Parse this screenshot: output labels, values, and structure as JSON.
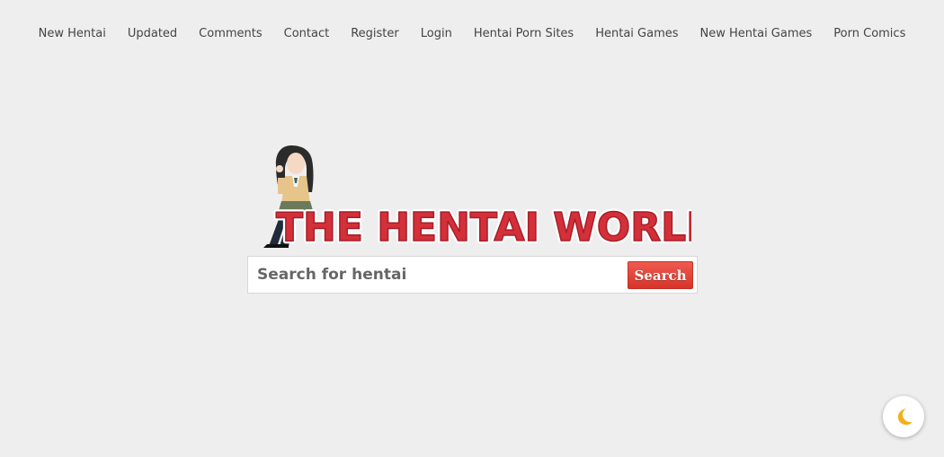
{
  "nav": {
    "items": [
      {
        "label": "New Hentai"
      },
      {
        "label": "Updated"
      },
      {
        "label": "Comments"
      },
      {
        "label": "Contact"
      },
      {
        "label": "Register"
      },
      {
        "label": "Login"
      },
      {
        "label": "Hentai Porn Sites"
      },
      {
        "label": "Hentai Games"
      },
      {
        "label": "New Hentai Games"
      },
      {
        "label": "Porn Comics"
      }
    ]
  },
  "logo": {
    "text": "THE HENTAI WORLD",
    "icon": "anime-girl-mascot"
  },
  "search": {
    "placeholder": "Search for hentai",
    "value": "",
    "button_label": "Search"
  },
  "theme_toggle": {
    "icon": "moon-icon"
  },
  "colors": {
    "background": "#eeeeee",
    "accent": "#d7342a",
    "logo_red": "#d4303a",
    "nav_text": "#444444",
    "moon": "#f2b01e"
  }
}
